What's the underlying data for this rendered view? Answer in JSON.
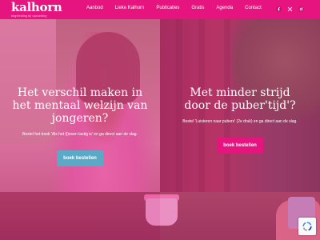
{
  "brand": {
    "name": "kalhorn",
    "tagline": "begeleiding bij opvoeding"
  },
  "nav": {
    "items": [
      "Aanbod",
      "Lieke Kalhorn",
      "Publicaties",
      "Gratis",
      "Agenda",
      "Contact"
    ]
  },
  "socials": {
    "icons": [
      "facebook-icon",
      "x-icon",
      "instagram-icon"
    ]
  },
  "colors": {
    "header": "#e5147f",
    "overlay_pink": "#e52a8e",
    "button_blue": "#5aa9c7",
    "button_pink": "#e5147f"
  },
  "hero": {
    "left": {
      "headline": "Het verschil maken in het mentaal welzijn van jongeren?",
      "description": "Bestel het boek 'Als het (l)even lastig is' en ga direct aan de slag.",
      "button": "boek bestellen"
    },
    "right": {
      "headline": "Met minder strijd door de puber'tijd'?",
      "description": "Bestel 'Luisteren naar pubers' (2e druk) en ga direct aan de slag.",
      "button": "boek bestellen"
    }
  }
}
